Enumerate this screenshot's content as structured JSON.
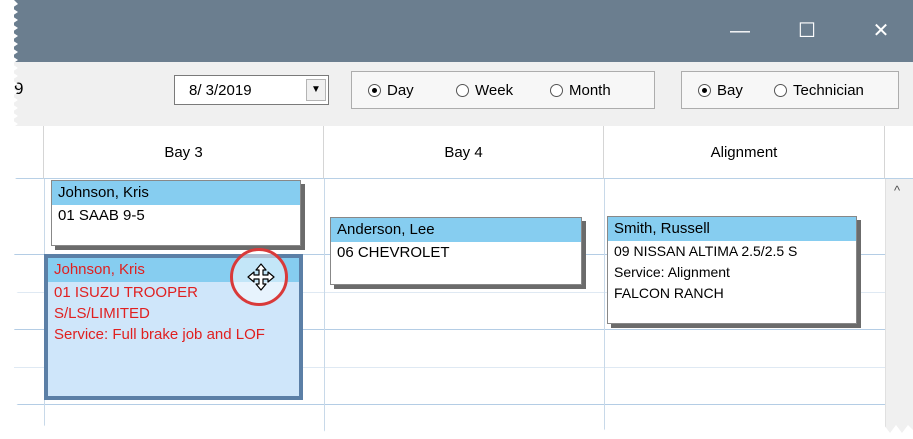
{
  "window": {
    "minimize_label": "—",
    "maximize_label": "☐",
    "close_label": "✕"
  },
  "toolbar": {
    "left_fragment": "9",
    "date_value": "8/  3/2019",
    "view_options": [
      "Day",
      "Week",
      "Month"
    ],
    "view_selected": "Day",
    "group_options": [
      "Bay",
      "Technician"
    ],
    "group_selected": "Bay"
  },
  "columns": [
    "Bay 3",
    "Bay 4",
    "Alignment"
  ],
  "appointments": [
    {
      "column": "Bay 3",
      "name": "Johnson, Kris",
      "lines": [
        "01 SAAB 9-5"
      ],
      "selected": false
    },
    {
      "column": "Bay 3",
      "name": "Johnson, Kris",
      "lines": [
        "01 ISUZU TROOPER S/LS/LIMITED",
        "Service: Full brake job and LOF"
      ],
      "selected": true
    },
    {
      "column": "Bay 4",
      "name": "Anderson, Lee",
      "lines": [
        "06 CHEVROLET"
      ],
      "selected": false
    },
    {
      "column": "Alignment",
      "name": "Smith, Russell",
      "lines": [
        "09 NISSAN ALTIMA 2.5/2.5 S",
        "Service: Alignment",
        "FALCON RANCH"
      ],
      "selected": false
    }
  ],
  "icons": [
    "move-cursor-icon",
    "scroll-up-arrow-icon",
    "dropdown-arrow-icon"
  ],
  "colors": {
    "titlebar": "#6b7e8f",
    "name_header": "#86cdf0",
    "selected_text": "#e02020",
    "selected_bg": "#cfe6fa",
    "highlight_ring": "#d93a3a"
  }
}
